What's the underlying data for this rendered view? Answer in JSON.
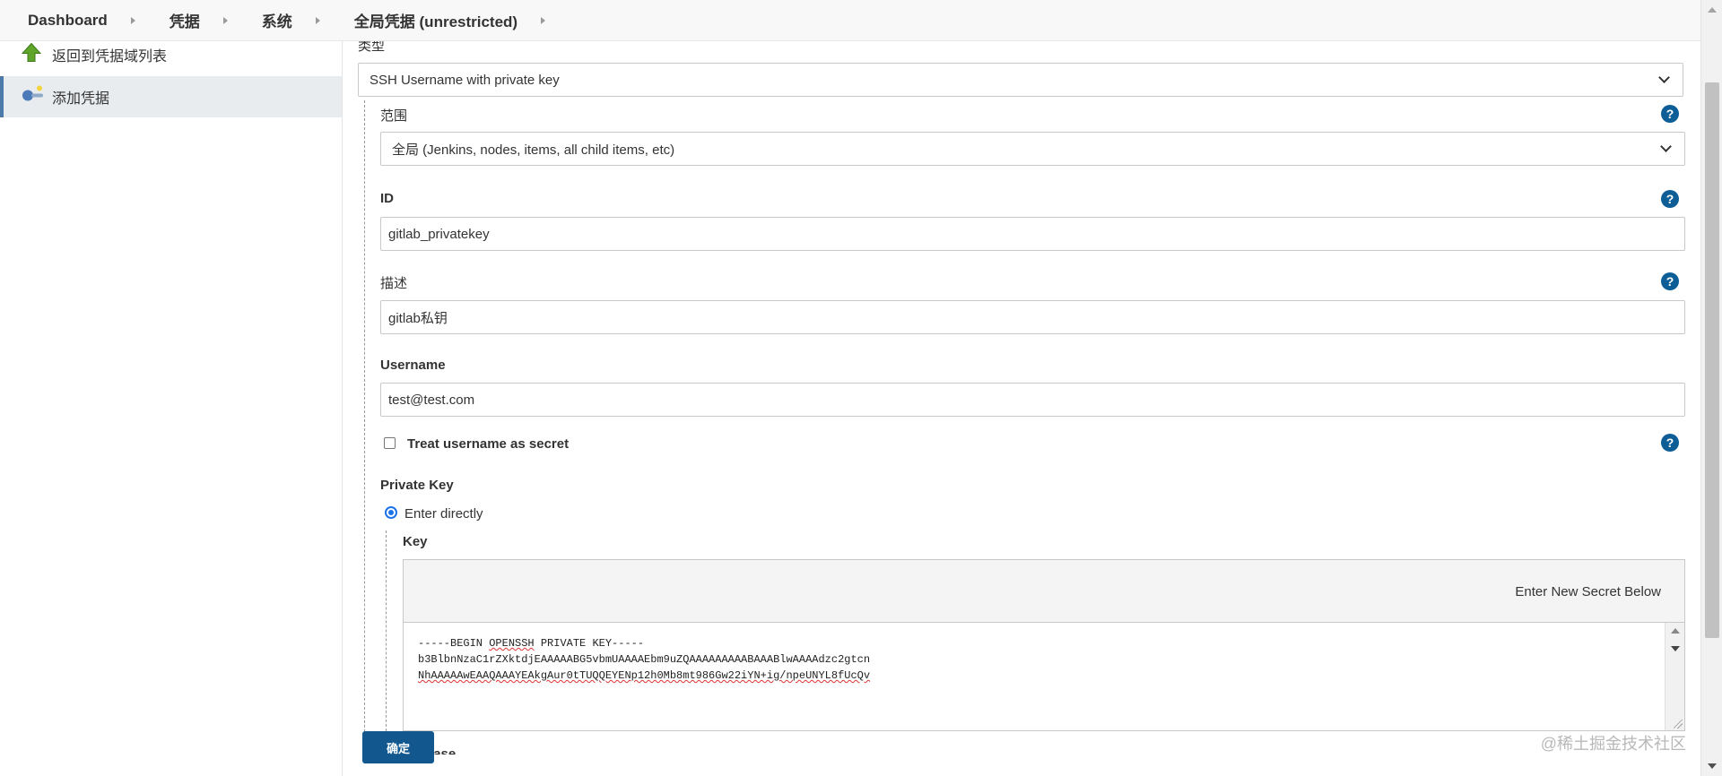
{
  "breadcrumb": [
    "Dashboard",
    "凭据",
    "系统",
    "全局凭据 (unrestricted)"
  ],
  "sidebar": {
    "items": [
      {
        "label": "返回到凭据域列表",
        "icon": "up-arrow-icon"
      },
      {
        "label": "添加凭据",
        "icon": "key-icon"
      }
    ]
  },
  "form": {
    "kind_label": "类型",
    "kind_value": "SSH Username with private key",
    "scope_label": "范围",
    "scope_value": "全局 (Jenkins, nodes, items, all child items, etc)",
    "id_label": "ID",
    "id_value": "gitlab_privatekey",
    "description_label": "描述",
    "description_value": "gitlab私钥",
    "username_label": "Username",
    "username_value": "test@test.com",
    "username_secret_label": "Treat username as secret",
    "private_key_label": "Private Key",
    "enter_directly_label": "Enter directly",
    "key_label": "Key",
    "key_header": "Enter New Secret Below",
    "key_lines": [
      "-----BEGIN OPENSSH PRIVATE KEY-----",
      "b3BlbnNzaC1rZXktdjEAAAAABG5vbmUAAAAEbm9uZQAAAAAAAAABAAABlwAAAAdzc2gtcn",
      "NhAAAAAwEAAQAAAYEAkgAur0tTUQQEYENp12h0Mb8mt986Gw22iYN+ig/npeUNYL8fUcQv"
    ],
    "passphrase_label": "Passphrase",
    "help_symbol": "?"
  },
  "actions": {
    "ok_label": "确定"
  },
  "watermark": "@稀土掘金技术社区",
  "colors": {
    "primary": "#12588f",
    "help": "#0d5e96",
    "radio": "#1a73e8",
    "sidebar_active": "#e9ecef"
  }
}
